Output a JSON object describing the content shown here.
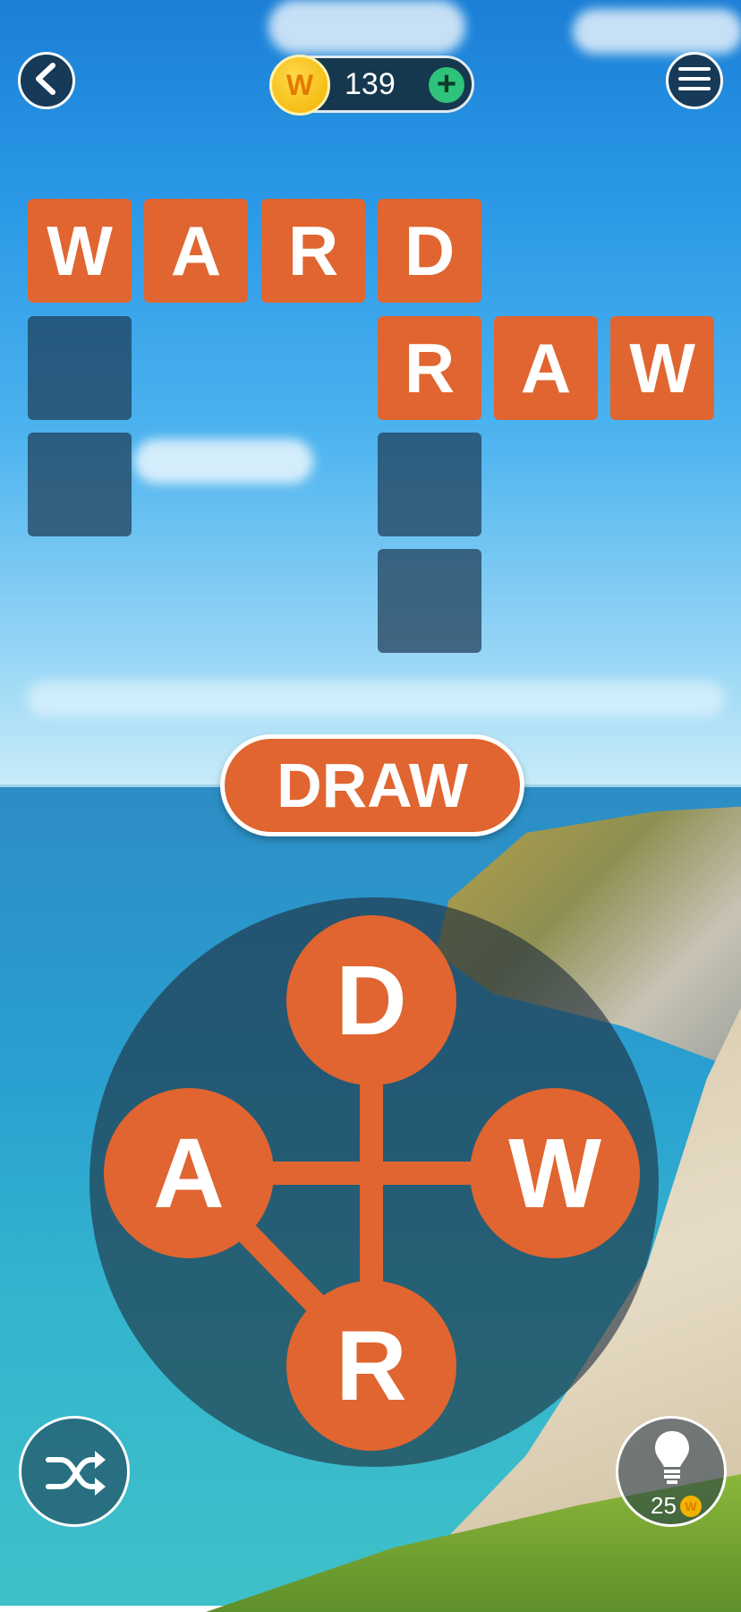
{
  "header": {
    "coin_symbol": "W",
    "coin_count": "139",
    "add_symbol": "+",
    "back_icon": "chevron-left-icon",
    "menu_icon": "hamburger-menu-icon"
  },
  "grid": {
    "word1": [
      "W",
      "A",
      "R",
      "D"
    ],
    "word2": [
      "R",
      "A",
      "W"
    ]
  },
  "current_word": "DRAW",
  "wheel": {
    "top": "D",
    "left": "A",
    "right": "W",
    "bottom": "R"
  },
  "bottom": {
    "shuffle_icon": "shuffle-icon",
    "hint_icon": "lightbulb-icon",
    "hint_cost": "25",
    "hint_coin_symbol": "W"
  },
  "colors": {
    "tile": "#e06530",
    "empty_tile": "#1e3c55",
    "coin": "#f2b300",
    "plus": "#2ec27a"
  }
}
